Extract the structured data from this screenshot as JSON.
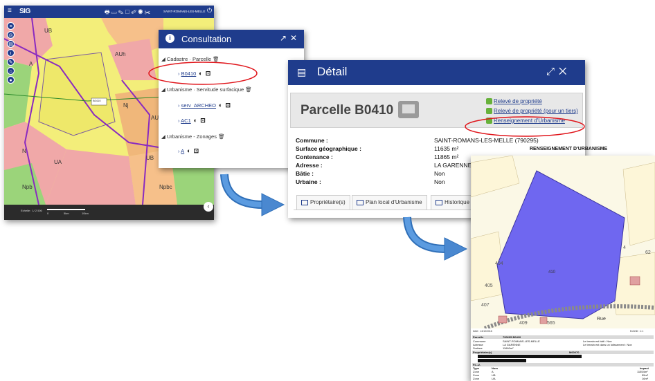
{
  "map_app": {
    "logo": "SIG",
    "commune": "SAINT-ROMANS-LES-MELLE",
    "scale_label": "Echelle : 1/ 2 500",
    "scale_ticks": [
      "0",
      "5km",
      "10km"
    ],
    "zone_labels": [
      "UB",
      "A",
      "AUh",
      "Nj",
      "AU",
      "N",
      "UA",
      "Npb",
      "Npbc",
      "UB",
      "UB",
      "B0410"
    ]
  },
  "consultation": {
    "title": "Consultation",
    "tree": [
      {
        "category": "Cadastre · Parcelle",
        "items": [
          "B0410"
        ]
      },
      {
        "category": "Urbanisme · Servitude surfacique",
        "items": [
          "serv_ARCHEO",
          "AC1"
        ]
      },
      {
        "category": "Urbanisme - Zonages",
        "items": [
          "A"
        ]
      }
    ]
  },
  "detail": {
    "title": "Détail",
    "parcelle_title": "Parcelle B0410",
    "links": [
      "Relevé de propriété",
      "Relevé de propriété (pour un tiers)",
      "Renseignement d'Urbanisme"
    ],
    "properties": [
      {
        "key": "Commune :",
        "value": "SAINT-ROMANS-LES-MELLE (790295)"
      },
      {
        "key": "Surface géographique :",
        "value": "11635 m²"
      },
      {
        "key": "Contenance :",
        "value": "11865 m²"
      },
      {
        "key": "Adresse :",
        "value": "LA GARENNE"
      },
      {
        "key": "Bâtie :",
        "value": "Non"
      },
      {
        "key": "Urbaine :",
        "value": "Non"
      }
    ],
    "tabs": [
      "Propriétaire(s)",
      "Plan local d'Urbanisme",
      "Historique"
    ]
  },
  "urbanisme_doc": {
    "title": "RENSEIGNEMENT D'URBANISME",
    "date": "Date : 14/10/2016",
    "scale": "Echelle : 1:1",
    "map_labels": [
      "404",
      "405",
      "407",
      "409",
      "565",
      "410",
      "4",
      "62",
      "Rue"
    ],
    "table": {
      "parcelle_hdr": [
        "Parcelle",
        "790295 B0410"
      ],
      "rows": [
        [
          "Commune",
          "SAINT-ROMANS-LES-MELLE",
          "Le terrain est bâti : Non"
        ],
        [
          "Adresse",
          "LA GARENNE",
          "Le terrain est dans un lotissement : Non"
        ],
        [
          "Surface",
          "11660m²",
          ""
        ]
      ],
      "proprietaire_hdr": [
        "Propriétaire(s)",
        "M00070"
      ],
      "plu_hdr": "P.L.U.",
      "zone_hdr": [
        "Type",
        "Nom",
        "Impact"
      ],
      "zones": [
        [
          "Zone",
          "A",
          "11554m²"
        ],
        [
          "Zone",
          "UB",
          "55m²"
        ],
        [
          "Zone",
          "UA",
          "16m²"
        ]
      ]
    }
  },
  "colors": {
    "primary": "#1f3c8c",
    "zone_yellow": "#f3ee7a",
    "zone_pink": "#f0a8a8",
    "zone_green": "#9bd47a",
    "parcel_highlight": "#6f67f0",
    "circle_red": "#e0141a",
    "arrow_blue": "#3b7fd0"
  }
}
